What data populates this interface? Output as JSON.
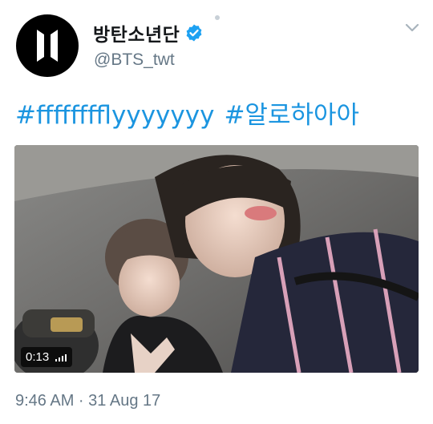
{
  "tweet": {
    "display_name": "방탄소년단",
    "handle": "@BTS_twt",
    "hashtags": [
      "#fffffffflyyyyyyy",
      "#알로하아아"
    ],
    "timestamp": "9:46 AM · 31 Aug 17"
  },
  "media": {
    "duration": "0:13",
    "icon": "volume-bars-icon"
  },
  "colors": {
    "link": "#1b95e0",
    "verified": "#1da1f2",
    "secondary_text": "#657786",
    "primary_text": "#14171a"
  },
  "icons": {
    "verified": "verified-badge-icon",
    "more": "chevron-down-icon",
    "avatar_logo": "bts-logo-icon"
  }
}
